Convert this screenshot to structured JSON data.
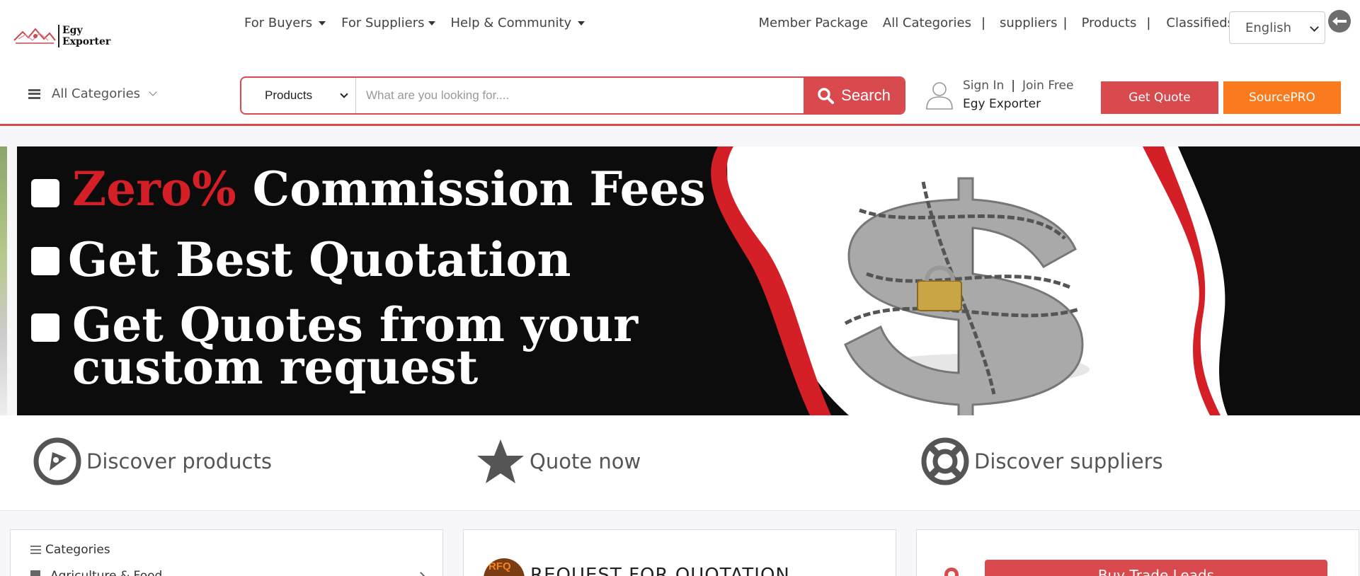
{
  "brand": {
    "line1": "Egy",
    "line2": "Exporter"
  },
  "nav": {
    "buyers": "For Buyers",
    "suppliers": "For Suppliers",
    "help": "Help & Community",
    "member_package": "Member Package",
    "all_categories": "All Categories",
    "suppliers_link": "suppliers",
    "products_link": "Products",
    "classifieds": "Classifieds",
    "separator": "|"
  },
  "language": {
    "selected": "English"
  },
  "categories_menu": {
    "label": "All Categories"
  },
  "search": {
    "type_selected": "Products",
    "placeholder": "What are you looking for....",
    "button": "Search"
  },
  "user": {
    "sign_in": "Sign In",
    "separator": "|",
    "join": "Join Free",
    "name": "Egy Exporter"
  },
  "actions": {
    "get_quote": "Get Quote",
    "source_pro": "SourcePRO"
  },
  "banner": {
    "line1_highlight": "Zero%",
    "line1_rest": " Commission Fees",
    "line2": "Get Best Quotation",
    "line3a": "Get Quotes from your",
    "line3b": "custom request"
  },
  "quick_links": [
    {
      "label": "Discover products",
      "icon": "compass-icon"
    },
    {
      "label": "Quote now",
      "icon": "star-icon"
    },
    {
      "label": "Discover suppliers",
      "icon": "lifebuoy-icon"
    }
  ],
  "cards": {
    "categories_title": "Categories",
    "first_category": "Agriculture & Food",
    "rfq_badge": "RFQ",
    "rfq_title": "REQUEST FOR QUOTATION",
    "trade_leads": "Buy Trade Leads"
  },
  "colors": {
    "accent": "#d94a4f",
    "orange": "#fa7a1e",
    "banner_red": "#d41f26"
  }
}
